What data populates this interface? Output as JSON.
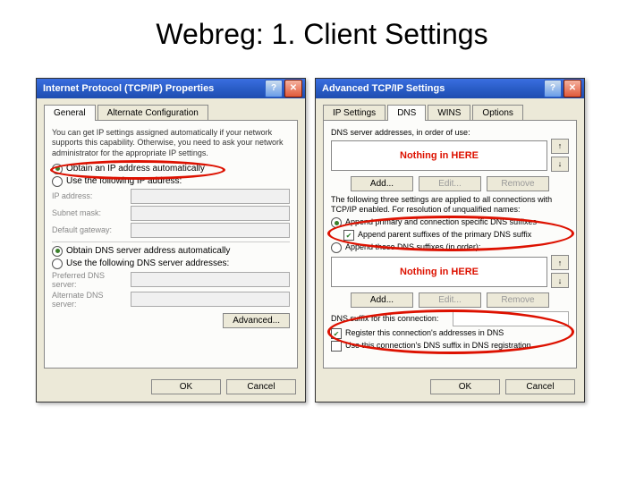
{
  "slide_title": "Webreg: 1. Client Settings",
  "annotations": {
    "nothing_here": "Nothing in HERE"
  },
  "left": {
    "title": "Internet Protocol (TCP/IP) Properties",
    "close_glyph": "✕",
    "help_glyph": "?",
    "tabs": [
      "General",
      "Alternate Configuration"
    ],
    "hint": "You can get IP settings assigned automatically if your network supports this capability. Otherwise, you need to ask your network administrator for the appropriate IP settings.",
    "ip": {
      "auto": "Obtain an IP address automatically",
      "manual": "Use the following IP address:",
      "addr_label": "IP address:",
      "mask_label": "Subnet mask:",
      "gw_label": "Default gateway:"
    },
    "dns": {
      "auto": "Obtain DNS server address automatically",
      "manual": "Use the following DNS server addresses:",
      "pref_label": "Preferred DNS server:",
      "alt_label": "Alternate DNS server:"
    },
    "buttons": {
      "advanced": "Advanced...",
      "ok": "OK",
      "cancel": "Cancel"
    }
  },
  "right": {
    "title": "Advanced TCP/IP Settings",
    "close_glyph": "✕",
    "help_glyph": "?",
    "tabs": [
      "IP Settings",
      "DNS",
      "WINS",
      "Options"
    ],
    "dns_list_label": "DNS server addresses, in order of use:",
    "btns": {
      "add": "Add...",
      "edit": "Edit...",
      "remove": "Remove",
      "up": "↑",
      "down": "↓"
    },
    "resolve_hint": "The following three settings are applied to all connections with TCP/IP enabled. For resolution of unqualified names:",
    "suffix": {
      "append_primary": "Append primary and connection specific DNS suffixes",
      "append_parent": "Append parent suffixes of the primary DNS suffix",
      "append_these": "Append these DNS suffixes (in order):"
    },
    "conn_suffix_label": "DNS suffix for this connection:",
    "register": {
      "reg_addr": "Register this connection's addresses in DNS",
      "use_suffix": "Use this connection's DNS suffix in DNS registration"
    },
    "buttons": {
      "ok": "OK",
      "cancel": "Cancel"
    }
  }
}
